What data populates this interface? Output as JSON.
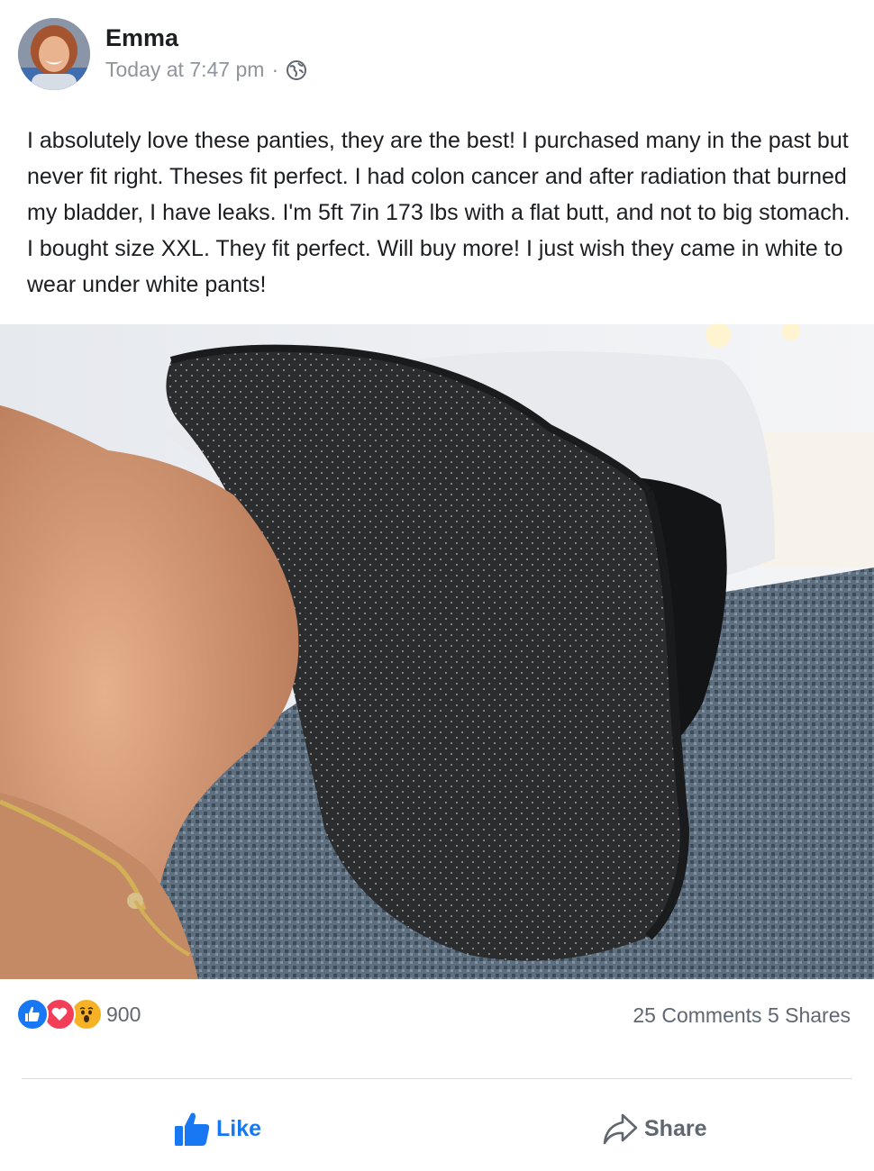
{
  "post": {
    "author": "Emma",
    "timestamp": "Today at 7:47 pm",
    "separator": "·",
    "privacy_icon": "globe-icon",
    "text": "I absolutely love these panties, they are the best! I purchased many in the past but never fit right. Theses fit perfect. I had colon cancer and after radiation that burned my bladder, I have leaks. I'm 5ft 7in 173 lbs with a flat butt, and not to big stomach. I bought size XXL. They fit perfect. Will buy more! I just wish they came in white to wear under white pants!"
  },
  "reactions": {
    "types": [
      "like-reaction-icon",
      "love-reaction-icon",
      "wow-reaction-icon"
    ],
    "count": "900",
    "comments": "25 Comments",
    "shares": "5 Shares"
  },
  "actions": {
    "like_label": "Like",
    "share_label": "Share"
  },
  "colors": {
    "brand_blue": "#1877f2",
    "love_red": "#f33e58",
    "wow_yellow": "#f7b125",
    "secondary_text": "#606770"
  }
}
